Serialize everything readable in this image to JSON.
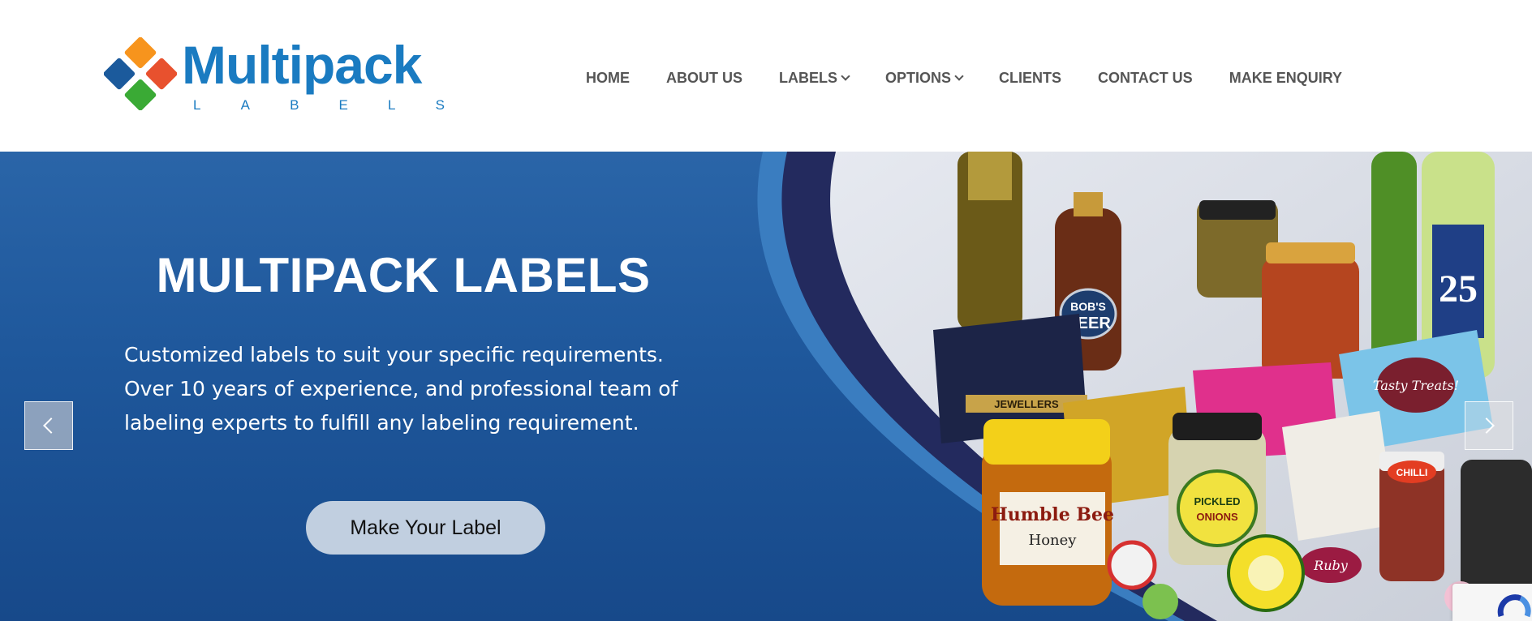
{
  "brand": {
    "name": "Multipack",
    "sub_letters": [
      "L",
      "A",
      "B",
      "E",
      "L",
      "S"
    ],
    "colors": {
      "blue": "#1a7bc1",
      "orange": "#f7941d",
      "green": "#3aaa35",
      "navy": "#1b5a9c"
    }
  },
  "nav": {
    "items": [
      {
        "label": "HOME",
        "dropdown": false
      },
      {
        "label": "ABOUT US",
        "dropdown": false
      },
      {
        "label": "LABELS",
        "dropdown": true
      },
      {
        "label": "OPTIONS",
        "dropdown": true
      },
      {
        "label": "CLIENTS",
        "dropdown": false
      },
      {
        "label": "CONTACT US",
        "dropdown": false
      },
      {
        "label": "MAKE ENQUIRY",
        "dropdown": false
      }
    ]
  },
  "hero": {
    "title": "MULTIPACK LABELS",
    "text": "Customized labels to suit your specific requirements. Over 10 years of experience, and professional team of labeling experts to fulfill any labeling requirement.",
    "button_label": "Make Your Label",
    "prev_icon": "chevron-left-icon",
    "next_icon": "chevron-right-icon",
    "photo_labels": {
      "bobs": "BOB'S",
      "beer": "BEER",
      "jewellers": "JEWELLERS",
      "humble_bee": "Humble Bee",
      "honey": "Honey",
      "pickled": "PICKLED",
      "onions": "ONIONS",
      "tasty": "Tasty Treats!",
      "anniversary": "25",
      "chilli": "CHILLI",
      "ruby": "Ruby"
    }
  }
}
